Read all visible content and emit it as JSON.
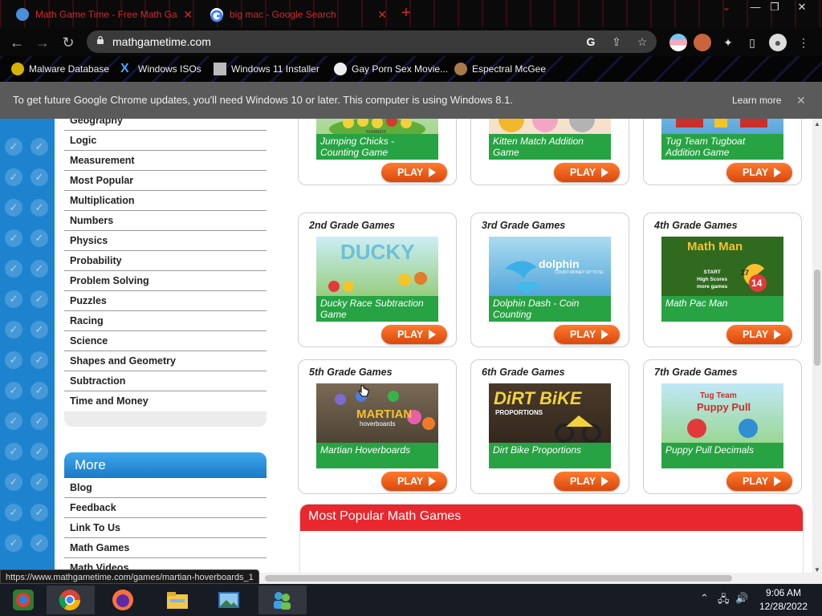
{
  "browser": {
    "tabs": [
      {
        "title": "Math Game Time - Free Math Ga",
        "active": true
      },
      {
        "title": "big mac - Google Search",
        "active": false
      }
    ],
    "new_tab_symbol": "+",
    "url": "mathgametime.com",
    "infobar": {
      "message": "To get future Google Chrome updates, you'll need Windows 10 or later. This computer is using Windows 8.1.",
      "learn_more": "Learn more"
    },
    "bookmarks": [
      {
        "label": "Malware Database"
      },
      {
        "label": "Windows ISOs"
      },
      {
        "label": "Windows 11 Installer"
      },
      {
        "label": "Gay Porn Sex Movie..."
      },
      {
        "label": "Espectral McGee"
      }
    ]
  },
  "sidebar": {
    "categories": [
      "Geography",
      "Logic",
      "Measurement",
      "Most Popular",
      "Multiplication",
      "Numbers",
      "Physics",
      "Probability",
      "Problem Solving",
      "Puzzles",
      "Racing",
      "Science",
      "Shapes and Geometry",
      "Subtraction",
      "Time and Money"
    ],
    "more_title": "More",
    "more_links": [
      "Blog",
      "Feedback",
      "Link To Us",
      "Math Games",
      "Math Videos"
    ]
  },
  "games": [
    {
      "grade": "",
      "title": "Jumping Chicks - Counting Game",
      "play": "PLAY"
    },
    {
      "grade": "",
      "title": "Kitten Match Addition Game",
      "play": "PLAY"
    },
    {
      "grade": "",
      "title": "Tug Team Tugboat Addition Game",
      "play": "PLAY"
    },
    {
      "grade": "2nd Grade Games",
      "title": "Ducky Race Subtraction Game",
      "play": "PLAY"
    },
    {
      "grade": "3rd Grade Games",
      "title": "Dolphin Dash - Coin Counting",
      "play": "PLAY"
    },
    {
      "grade": "4th Grade Games",
      "title": "Math Pac Man",
      "play": "PLAY"
    },
    {
      "grade": "5th Grade Games",
      "title": "Martian Hoverboards",
      "play": "PLAY"
    },
    {
      "grade": "6th Grade Games",
      "title": "Dirt Bike Proportions",
      "play": "PLAY"
    },
    {
      "grade": "7th Grade Games",
      "title": "Puppy Pull Decimals",
      "play": "PLAY"
    }
  ],
  "thumb_text": {
    "ducky": "DUCKY",
    "dolphin": "dolphin",
    "dolphin_sub": "COUNT MONEY UP TO $1",
    "mathman": "Math Man",
    "mathman_menu": "START\nHigh Scores\nmore games",
    "mathman_n1": "27",
    "mathman_n2": "14",
    "martian": "MARTIAN",
    "martian_sub": "hoverboards",
    "dirtbike": "DiRT BiKE",
    "dirtbike_sub": "PROPORTIONS",
    "puppy": "Tug Team",
    "puppy_sub": "Puppy Pull",
    "numbers_label": "NUMBERS"
  },
  "popular_title": "Most Popular Math Games",
  "status_url": "https://www.mathgametime.com/games/martian-hoverboards_1",
  "taskbar": {
    "time": "9:06 AM",
    "date": "12/28/2022"
  }
}
